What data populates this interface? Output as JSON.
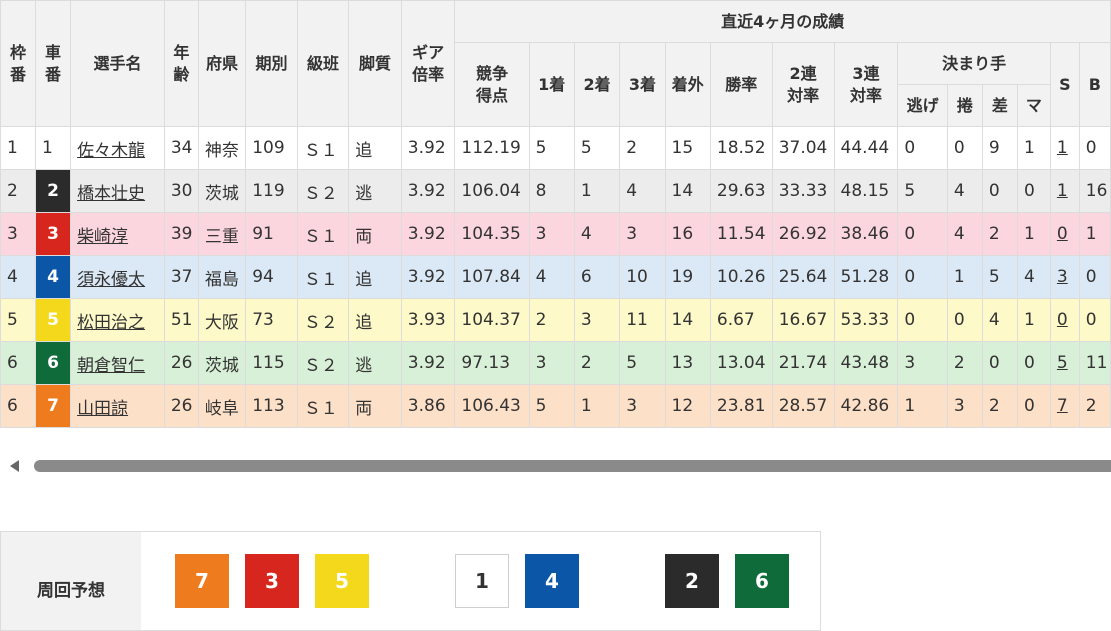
{
  "headers": {
    "waku": "枠\n番",
    "sha": "車\n番",
    "name": "選手名",
    "age": "年\n齢",
    "pref": "府県",
    "term": "期別",
    "class": "級班",
    "style": "脚質",
    "gear": "ギア\n倍率",
    "recent_group": "直近4ヶ月の成績",
    "score": "競争\n得点",
    "first": "1着",
    "second": "2着",
    "third": "3着",
    "out": "着外",
    "win_rate": "勝率",
    "quinella_rate": "2連\n対率",
    "trio_rate": "3連\n対率",
    "kimarite_group": "決まり手",
    "nige": "逃げ",
    "makuri": "捲",
    "sashi": "差",
    "mark": "マ",
    "s": "S",
    "b": "B"
  },
  "rows": [
    {
      "waku": "1",
      "car": "1",
      "name": "佐々木龍",
      "age": "34",
      "pref": "神奈",
      "term": "109",
      "class": "Ｓ１",
      "style": "追",
      "gear": "3.92",
      "score": "112.19",
      "first": "5",
      "second": "5",
      "third": "2",
      "out": "15",
      "win": "18.52",
      "quin": "37.04",
      "trio": "44.44",
      "nige": "0",
      "makuri": "0",
      "sashi": "9",
      "mark": "1",
      "s": "1",
      "b": "0"
    },
    {
      "waku": "2",
      "car": "2",
      "name": "橋本壮史",
      "age": "30",
      "pref": "茨城",
      "term": "119",
      "class": "Ｓ２",
      "style": "逃",
      "gear": "3.92",
      "score": "106.04",
      "first": "8",
      "second": "1",
      "third": "4",
      "out": "14",
      "win": "29.63",
      "quin": "33.33",
      "trio": "48.15",
      "nige": "5",
      "makuri": "4",
      "sashi": "0",
      "mark": "0",
      "s": "1",
      "b": "16"
    },
    {
      "waku": "3",
      "car": "3",
      "name": "柴崎淳",
      "age": "39",
      "pref": "三重",
      "term": "91",
      "class": "Ｓ１",
      "style": "両",
      "gear": "3.92",
      "score": "104.35",
      "first": "3",
      "second": "4",
      "third": "3",
      "out": "16",
      "win": "11.54",
      "quin": "26.92",
      "trio": "38.46",
      "nige": "0",
      "makuri": "4",
      "sashi": "2",
      "mark": "1",
      "s": "0",
      "b": "1"
    },
    {
      "waku": "4",
      "car": "4",
      "name": "須永優太",
      "age": "37",
      "pref": "福島",
      "term": "94",
      "class": "Ｓ１",
      "style": "追",
      "gear": "3.92",
      "score": "107.84",
      "first": "4",
      "second": "6",
      "third": "10",
      "out": "19",
      "win": "10.26",
      "quin": "25.64",
      "trio": "51.28",
      "nige": "0",
      "makuri": "1",
      "sashi": "5",
      "mark": "4",
      "s": "3",
      "b": "0"
    },
    {
      "waku": "5",
      "car": "5",
      "name": "松田治之",
      "age": "51",
      "pref": "大阪",
      "term": "73",
      "class": "Ｓ２",
      "style": "追",
      "gear": "3.93",
      "score": "104.37",
      "first": "2",
      "second": "3",
      "third": "11",
      "out": "14",
      "win": "6.67",
      "quin": "16.67",
      "trio": "53.33",
      "nige": "0",
      "makuri": "0",
      "sashi": "4",
      "mark": "1",
      "s": "0",
      "b": "0"
    },
    {
      "waku": "6",
      "car": "6",
      "name": "朝倉智仁",
      "age": "26",
      "pref": "茨城",
      "term": "115",
      "class": "Ｓ２",
      "style": "逃",
      "gear": "3.92",
      "score": "97.13",
      "first": "3",
      "second": "2",
      "third": "5",
      "out": "13",
      "win": "13.04",
      "quin": "21.74",
      "trio": "43.48",
      "nige": "3",
      "makuri": "2",
      "sashi": "0",
      "mark": "0",
      "s": "5",
      "b": "11"
    },
    {
      "waku": "6",
      "car": "7",
      "name": "山田諒",
      "age": "26",
      "pref": "岐阜",
      "term": "113",
      "class": "Ｓ１",
      "style": "両",
      "gear": "3.86",
      "score": "106.43",
      "first": "5",
      "second": "1",
      "third": "3",
      "out": "12",
      "win": "23.81",
      "quin": "28.57",
      "trio": "42.86",
      "nige": "1",
      "makuri": "3",
      "sashi": "2",
      "mark": "0",
      "s": "7",
      "b": "2"
    }
  ],
  "car_colors": {
    "2": {
      "bg": "#2b2b2b",
      "fg": "#ffffff"
    },
    "3": {
      "bg": "#d7261e",
      "fg": "#ffffff"
    },
    "4": {
      "bg": "#0b56a6",
      "fg": "#ffffff"
    },
    "5": {
      "bg": "#f3d81c",
      "fg": "#ffffff"
    },
    "6": {
      "bg": "#0f6b3a",
      "fg": "#ffffff"
    },
    "7": {
      "bg": "#ee7b1e",
      "fg": "#ffffff"
    }
  },
  "prediction": {
    "label": "周回予想",
    "order": [
      {
        "car": "7",
        "bg": "#ee7b1e",
        "fg": "#ffffff"
      },
      {
        "car": "3",
        "bg": "#d7261e",
        "fg": "#ffffff"
      },
      {
        "car": "5",
        "bg": "#f3d81c",
        "fg": "#ffffff"
      },
      {
        "car": "1",
        "bg": "#ffffff",
        "fg": "#333333"
      },
      {
        "car": "4",
        "bg": "#0b56a6",
        "fg": "#ffffff"
      },
      {
        "car": "2",
        "bg": "#2b2b2b",
        "fg": "#ffffff"
      },
      {
        "car": "6",
        "bg": "#0f6b3a",
        "fg": "#ffffff"
      }
    ]
  }
}
